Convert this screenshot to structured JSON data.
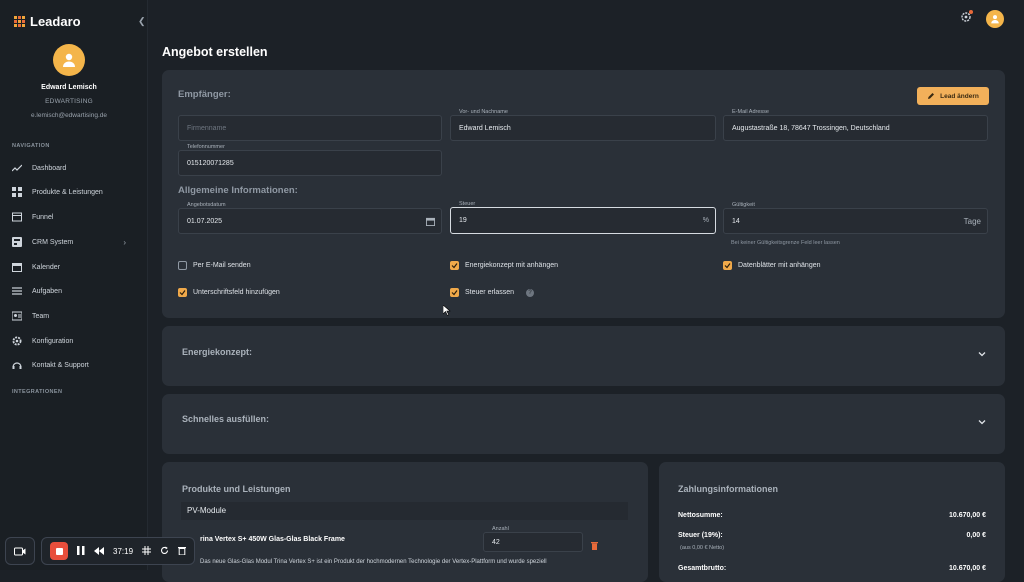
{
  "app": {
    "name": "Leadaro",
    "collapse_icon": "chevron-left-icon"
  },
  "user": {
    "name": "Edward Lemisch",
    "company": "EDWARTISING",
    "email": "e.lemisch@edwartising.de"
  },
  "nav": {
    "heading": "NAVIGATION",
    "items": [
      {
        "label": "Dashboard",
        "icon": "trend-icon"
      },
      {
        "label": "Produkte & Leistungen",
        "icon": "grid-icon"
      },
      {
        "label": "Funnel",
        "icon": "funnel-icon"
      },
      {
        "label": "CRM System",
        "icon": "crm-icon"
      },
      {
        "label": "Kalender",
        "icon": "calendar-icon"
      },
      {
        "label": "Aufgaben",
        "icon": "list-icon"
      },
      {
        "label": "Team",
        "icon": "team-icon"
      },
      {
        "label": "Konfiguration",
        "icon": "gear-icon"
      },
      {
        "label": "Kontakt & Support",
        "icon": "support-icon"
      }
    ],
    "integrations_heading": "INTEGRATIONEN"
  },
  "page": {
    "title": "Angebot erstellen"
  },
  "recipient": {
    "title": "Empfänger:",
    "lead_button": "Lead ändern",
    "company": {
      "placeholder": "Firmenname"
    },
    "name": {
      "label": "Vor- und Nachname",
      "value": "Edward Lemisch"
    },
    "email": {
      "label": "E-Mail Adresse",
      "value": "Augustastraße 18, 78647 Trossingen, Deutschland"
    },
    "phone": {
      "label": "Telefonnummer",
      "value": "015120071285"
    }
  },
  "general": {
    "title": "Allgemeine Informationen:",
    "date": {
      "label": "Angebotsdatum",
      "value": "01.07.2025"
    },
    "tax": {
      "label": "Steuer",
      "value": "19",
      "suffix": "%"
    },
    "validity": {
      "label": "Gültigkeit",
      "value": "14",
      "suffix": "Tage",
      "hint": "Bei keiner Gültigkeitsgrenze Feld leer lassen"
    }
  },
  "options": [
    {
      "label": "Per E-Mail senden",
      "checked": false
    },
    {
      "label": "Energiekonzept mit anhängen",
      "checked": true
    },
    {
      "label": "Datenblätter mit anhängen",
      "checked": true
    },
    {
      "label": "Unterschriftsfeld hinzufügen",
      "checked": true
    },
    {
      "label": "Steuer erlassen",
      "checked": true
    }
  ],
  "accordions": {
    "energy": "Energiekonzept:",
    "quickfill": "Schnelles ausfüllen:"
  },
  "products": {
    "title": "Produkte und Leistungen",
    "category": "PV-Module",
    "item_name": "rina Vertex S+ 450W Glas-Glas Black Frame",
    "qty_label": "Anzahl",
    "qty_value": "42",
    "desc": "Das neue Glas-Glas Modul Trina Vertex S+ ist ein Produkt der hochmodernen Technologie der Vertex-Plattform und wurde speziell"
  },
  "payment": {
    "title": "Zahlungsinformationen",
    "net_label": "Nettosumme:",
    "net_value": "10.670,00 €",
    "tax_label": "Steuer (19%):",
    "tax_value": "0,00 €",
    "tax_sub": "(aus 0,00 € Netto)",
    "gross_label": "Gesamtbrutto:",
    "gross_value": "10.670,00 €"
  },
  "recorder": {
    "time": "37:19"
  },
  "colors": {
    "accent": "#f0a94a",
    "danger": "#e84e3c",
    "card": "#2a3038",
    "bg": "#1c2127"
  }
}
